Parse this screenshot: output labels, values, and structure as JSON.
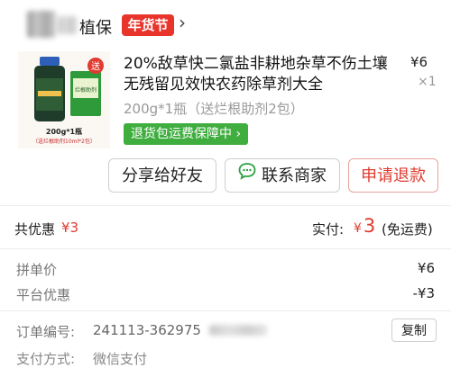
{
  "header": {
    "store_name_visible": "植保",
    "festival_badge": "年货节",
    "chevron": "›"
  },
  "product": {
    "title": "20%敌草快二氯盐非耕地杂草不伤土壤无残留见效快农药除草剂大全",
    "price": "¥6",
    "quantity": "×1",
    "spec": "200g*1瓶（送烂根助剂2包）",
    "return_badge": "退货包运费保障中 ›",
    "image": {
      "caption_line1": "200g*1瓶",
      "caption_line2": "（送烂根助剂10ml*2包）",
      "packet_label": "烂根助剂",
      "sticker_text": "送"
    }
  },
  "actions": {
    "share_label": "分享给好友",
    "contact_label": "联系商家",
    "refund_label": "申请退款",
    "contact_icon": "chat-bubble-icon"
  },
  "summary": {
    "discount_label": "共优惠",
    "discount_value": "¥3",
    "paid_label": "实付:",
    "paid_currency": "¥",
    "paid_amount": "3",
    "shipping_note": "(免运费)"
  },
  "details": {
    "group_price_label": "拼单价",
    "group_price_value": "¥6",
    "platform_discount_label": "平台优惠",
    "platform_discount_value": "-¥3"
  },
  "order": {
    "number_label": "订单编号:",
    "number_value": "241113-362975",
    "copy_label": "复制",
    "payment_label": "支付方式:",
    "payment_value": "微信支付"
  },
  "colors": {
    "accent_red": "#e03b30",
    "badge_green": "#3fae3f",
    "badge_red": "#e8342b"
  }
}
